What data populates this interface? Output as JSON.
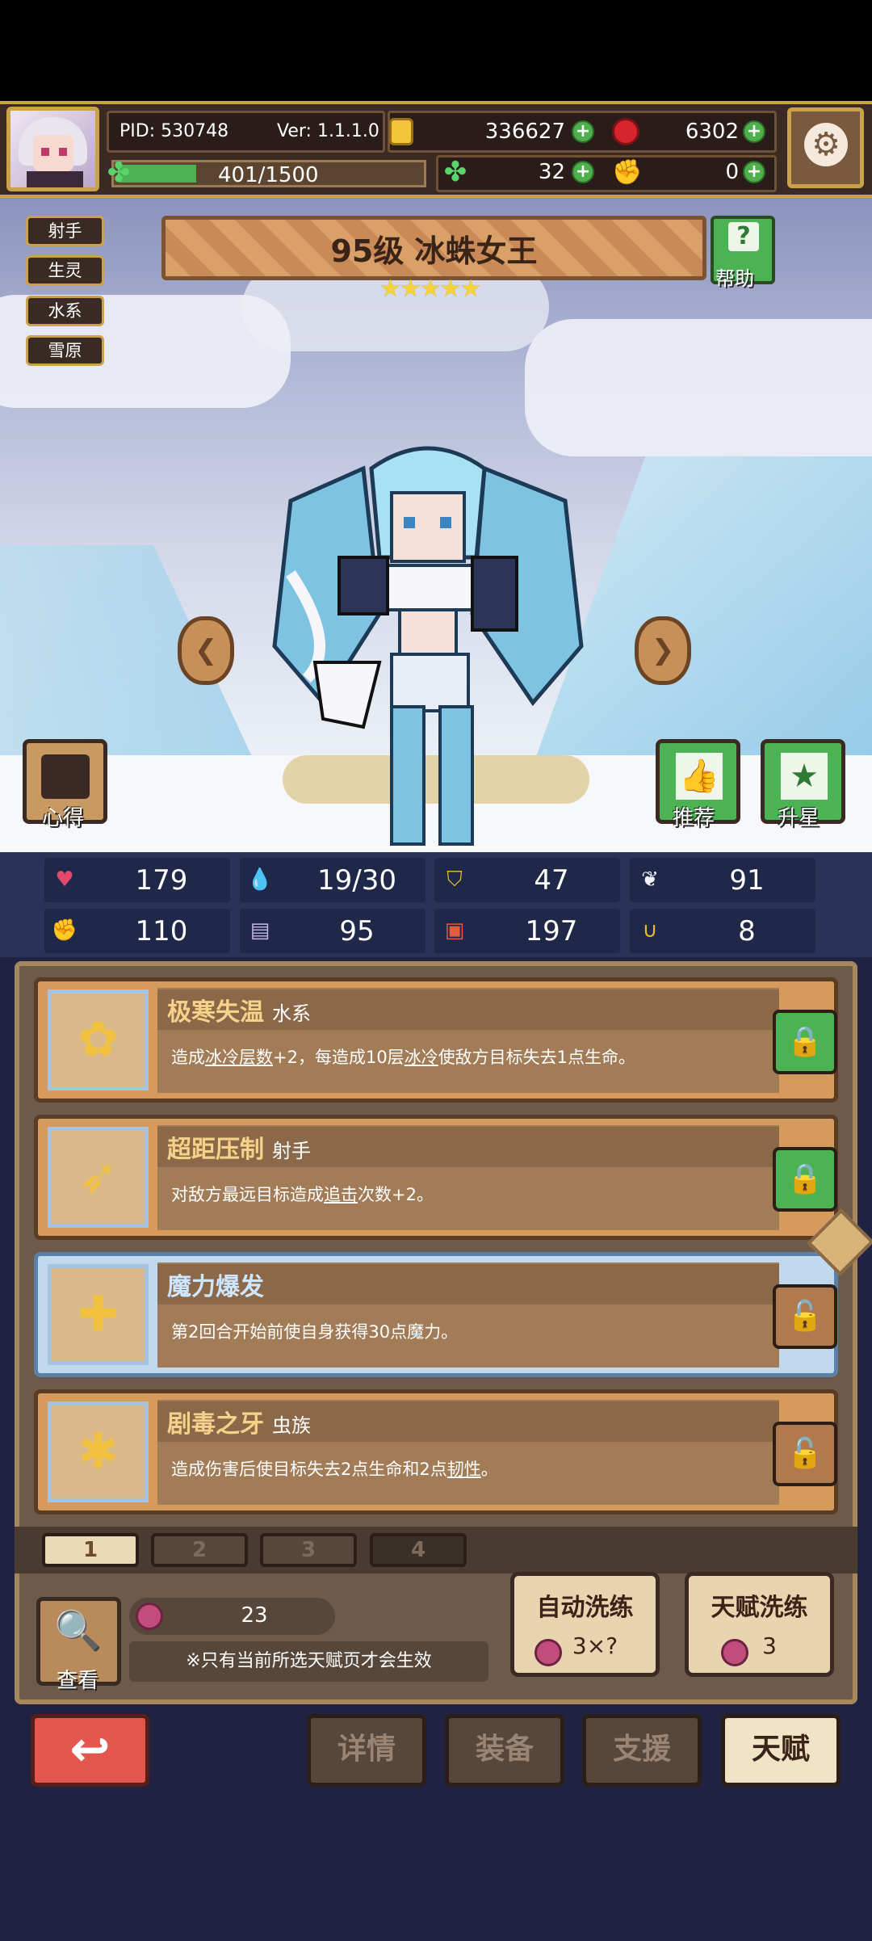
{
  "header": {
    "pid": "PID: 530748",
    "version": "Ver: 1.1.1.0",
    "gold": "336627",
    "gems": "6302",
    "exp": "401/1500",
    "exp_ratio": 0.27,
    "clover": "32",
    "hand": "0"
  },
  "tags": [
    "射手",
    "生灵",
    "水系",
    "雪原"
  ],
  "hero": {
    "title": "95级  冰蛛女王",
    "stars": 5,
    "help_label": "帮助",
    "star_glyphs": "★★★★★"
  },
  "side_buttons": {
    "insight": "心得",
    "recommend": "推荐",
    "upgrade_star": "升星"
  },
  "stats": [
    {
      "icon": "heart-icon",
      "value": "179"
    },
    {
      "icon": "water-drop-icon",
      "value": "19/30"
    },
    {
      "icon": "shield-icon",
      "value": "47"
    },
    {
      "icon": "wing-icon",
      "value": "91"
    },
    {
      "icon": "fist-icon",
      "value": "110"
    },
    {
      "icon": "book-icon",
      "value": "95"
    },
    {
      "icon": "card-icon",
      "value": "197"
    },
    {
      "icon": "horseshoe-icon",
      "value": "8"
    }
  ],
  "talents": [
    {
      "name": "极寒失温",
      "type": "水系",
      "desc_parts": [
        "造成",
        "冰冷层数",
        "+2，每造成10层",
        "冰冷",
        "使敌方目标失去1点生命。"
      ],
      "locked": true,
      "selected": false
    },
    {
      "name": "超距压制",
      "type": "射手",
      "desc_parts": [
        "对敌方最远目标造成",
        "追击",
        "次数+2。",
        "",
        ""
      ],
      "locked": true,
      "selected": false
    },
    {
      "name": "魔力爆发",
      "type": "",
      "desc_parts": [
        "第2回合开始前使自身获得30点魔力。",
        "",
        "",
        "",
        ""
      ],
      "locked": false,
      "selected": true
    },
    {
      "name": "剧毒之牙",
      "type": "虫族",
      "desc_parts": [
        "造成伤害后使目标失去2点生命和2点",
        "韧性",
        "。",
        "",
        ""
      ],
      "locked": false,
      "selected": false
    }
  ],
  "pages": [
    "1",
    "2",
    "3",
    "4"
  ],
  "active_page": "1",
  "controls": {
    "view_label": "查看",
    "potion_count": "23",
    "note": "※只有当前所选天赋页才会生效",
    "auto_refine": "自动洗练",
    "auto_refine_cost": "3×?",
    "talent_refine": "天赋洗练",
    "talent_refine_cost": "3"
  },
  "nav": {
    "details": "详情",
    "equipment": "装备",
    "support": "支援",
    "talent": "天赋",
    "active": "talent"
  }
}
